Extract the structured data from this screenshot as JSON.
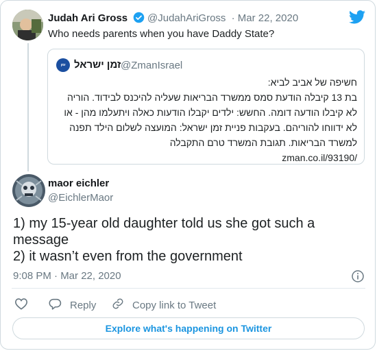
{
  "colors": {
    "accent": "#1da1f2",
    "link": "#1b95e0",
    "muted": "#697882",
    "border": "#cfd9de"
  },
  "quoted_tweet": {
    "author_name": "Judah Ari Gross",
    "author_handle": "@JudahAriGross",
    "date": "· Mar 22, 2020",
    "text": "Who needs parents when you have Daddy State?",
    "embedded": {
      "name": "זמן ישראל",
      "handle": "@ZmanIsrael",
      "lines": [
        "חשיפה של אביב לביא:",
        "בת 13 קיבלה הודעת סמס ממשרד הבריאות שעליה להיכנס לבידוד. הוריה",
        "לא קיבלו הודעה דומה. החשש: ילדים יקבלו הודעות כאלה ויתעלמו מהן - או",
        "לא ידווחו להוריהם. בעקבות פניית זמן ישראל: המועצה לשלום הילד תפנה",
        "למשרד הבריאות. תגובת המשרד טרם התקבלה"
      ],
      "link": "zman.co.il/93190/"
    }
  },
  "main_tweet": {
    "author_name": "maor eichler",
    "author_handle": "@EichlerMaor",
    "text_line1": "1) my 15-year old daughter told us she got such a",
    "text_line2": "message",
    "text_line3": "2) it wasn’t even from the government",
    "timestamp": "9:08 PM · Mar 22, 2020"
  },
  "actions": {
    "reply": "Reply",
    "copy_link": "Copy link to Tweet"
  },
  "explore_label": "Explore what's happening on Twitter",
  "icons": [
    "twitter-bird-icon",
    "verified-badge-icon",
    "info-icon",
    "heart-icon",
    "reply-icon",
    "link-icon"
  ]
}
